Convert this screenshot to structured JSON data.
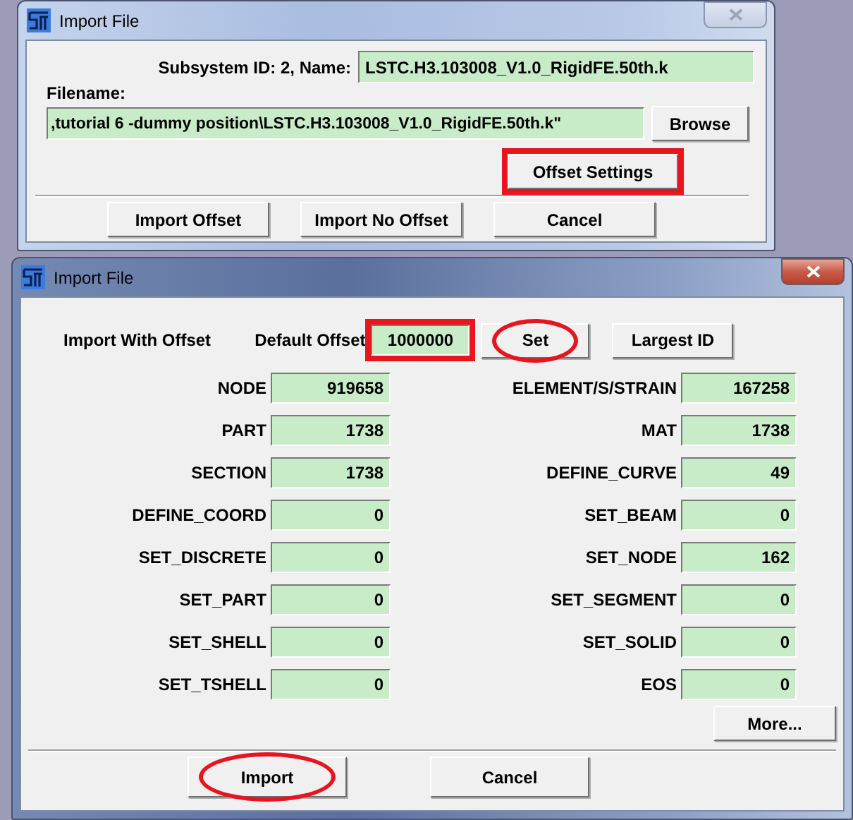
{
  "dialog_1": {
    "title": "Import File",
    "active": false,
    "subsystem_label": "Subsystem ID: 2, Name:",
    "name_value": "LSTC.H3.103008_V1.0_RigidFE.50th.k",
    "filename_label": "Filename:",
    "filename_value": ",tutorial 6 -dummy position\\LSTC.H3.103008_V1.0_RigidFE.50th.k\"",
    "browse_button": {
      "label": "Browse"
    },
    "offset_settings_button": {
      "label": "Offset Settings",
      "boxed": true
    },
    "buttons": [
      {
        "label": "Import Offset"
      },
      {
        "label": "Import No Offset"
      },
      {
        "label": "Cancel"
      }
    ]
  },
  "dialog_2": {
    "title": "Import File",
    "active": true,
    "import_with_offset_label": "Import With Offset",
    "default_offset_label": "Default Offset",
    "default_offset": {
      "value": "1000000",
      "boxed": true
    },
    "set_button": {
      "label": "Set",
      "circled": true
    },
    "largest_id_button": {
      "label": "Largest ID"
    },
    "fields": [
      {
        "label": "NODE",
        "value": "919658"
      },
      {
        "label": "ELEMENT/S/STRAIN",
        "value": "167258"
      },
      {
        "label": "PART",
        "value": "1738"
      },
      {
        "label": "MAT",
        "value": "1738"
      },
      {
        "label": "SECTION",
        "value": "1738"
      },
      {
        "label": "DEFINE_CURVE",
        "value": "49"
      },
      {
        "label": "DEFINE_COORD",
        "value": "0"
      },
      {
        "label": "SET_BEAM",
        "value": "0"
      },
      {
        "label": "SET_DISCRETE",
        "value": "0"
      },
      {
        "label": "SET_NODE",
        "value": "162"
      },
      {
        "label": "SET_PART",
        "value": "0"
      },
      {
        "label": "SET_SEGMENT",
        "value": "0"
      },
      {
        "label": "SET_SHELL",
        "value": "0"
      },
      {
        "label": "SET_SOLID",
        "value": "0"
      },
      {
        "label": "SET_TSHELL",
        "value": "0"
      },
      {
        "label": "EOS",
        "value": "0"
      }
    ],
    "more_button": {
      "label": "More..."
    },
    "buttons": [
      {
        "label": "Import",
        "circled": true
      },
      {
        "label": "Cancel"
      }
    ]
  }
}
